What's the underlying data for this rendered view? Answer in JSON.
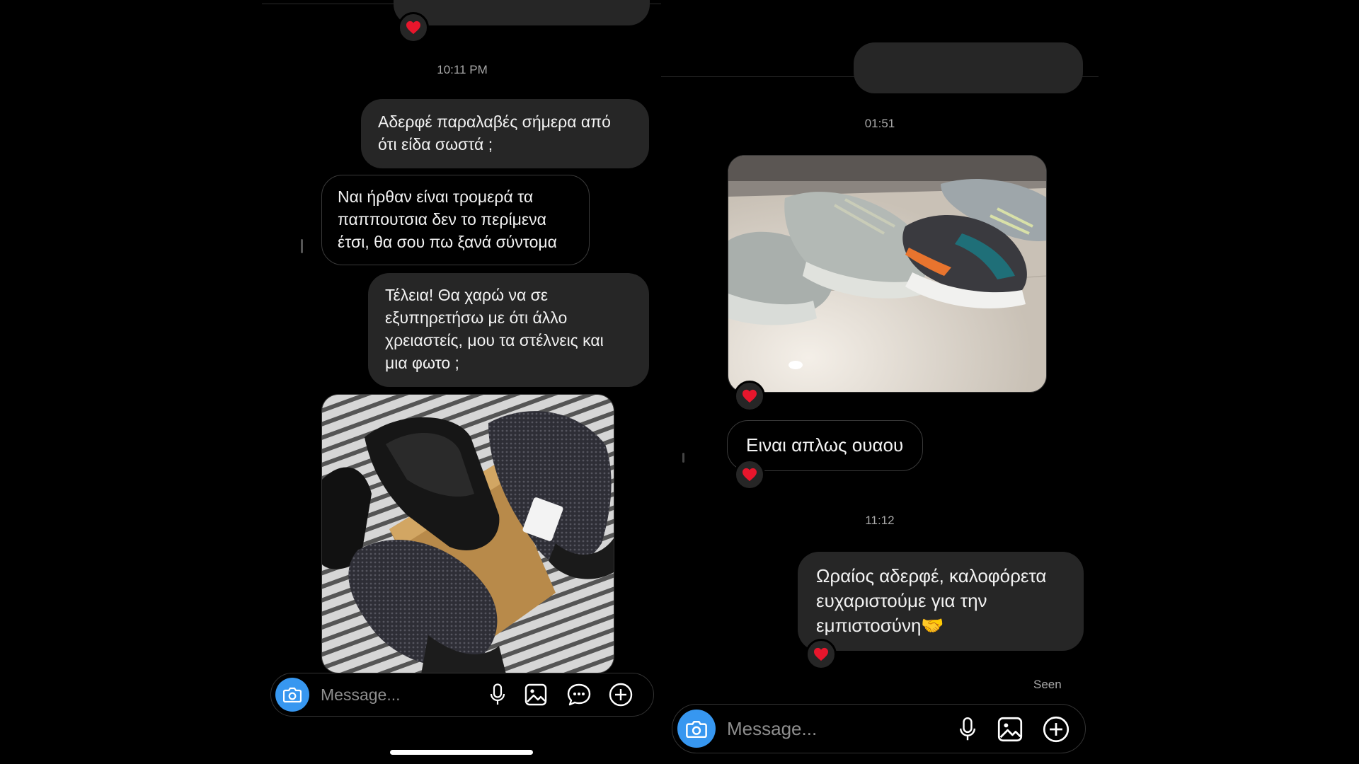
{
  "left_chat": {
    "time_separator": "10:11 PM",
    "messages": [
      {
        "text": "Αδερφέ παραλαβές σήμερα από\nότι είδα σωστά ;"
      },
      {
        "text": "Ναι ήρθαν είναι τρομερά τα\nπαππουτσια δεν το περίμενα\nέτσι, θα σου πω ξανά σύντομα"
      },
      {
        "text": "Τέλεια! Θα χαρώ να σε\nεξυπηρετήσω με ότι άλλο\nχρειαστείς, μου τα στέλνεις και\nμια φωτο ;"
      }
    ],
    "composer": {
      "placeholder": "Message..."
    }
  },
  "right_chat": {
    "time_separator_1": "01:51",
    "time_separator_2": "11:12",
    "messages": [
      {
        "text": "Ειναι απλως ουαου"
      },
      {
        "text": "Ωραίος αδερφέ, καλοφόρετα\nευχαριστούμε για την\nεμπιστοσύνη🤝"
      }
    ],
    "seen": "Seen",
    "composer": {
      "placeholder": "Message..."
    }
  },
  "colors": {
    "background": "#000000",
    "sent_bubble": "#262626",
    "accent_blue": "#3797f0",
    "heart": "#e8162c",
    "meta_text": "#a8a8a8"
  },
  "icons": [
    "camera-icon",
    "microphone-icon",
    "gallery-icon",
    "sticker-icon",
    "plus-circle-icon",
    "heart-icon"
  ]
}
